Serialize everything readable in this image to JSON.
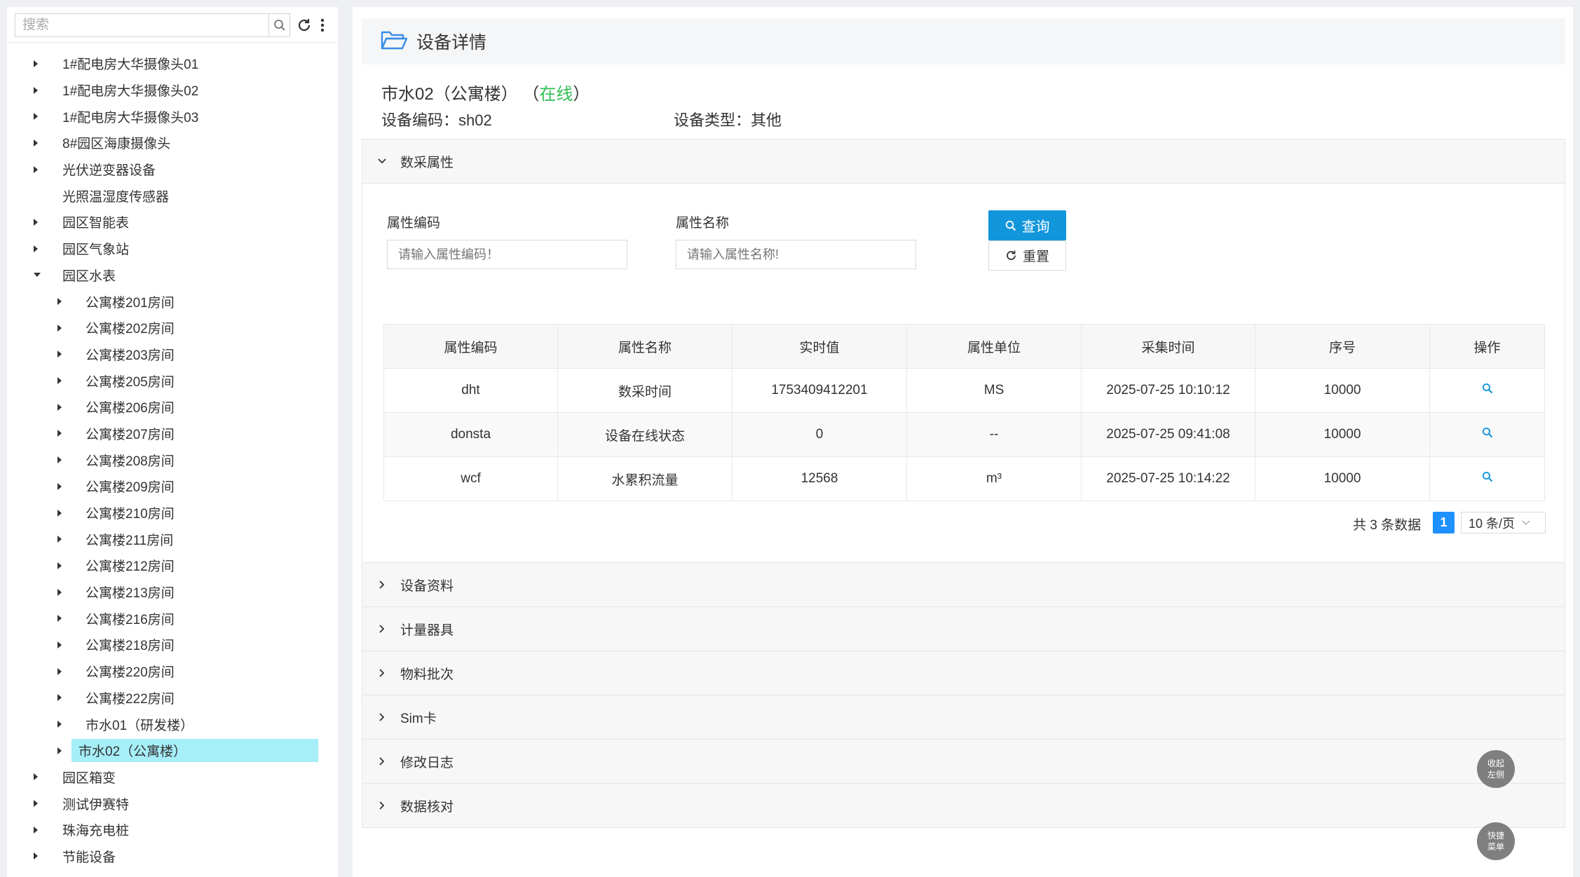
{
  "sidebar": {
    "search_placeholder": "搜索",
    "tree": [
      {
        "label": "1#配电房大华摄像头01",
        "level": 1,
        "caret": "right"
      },
      {
        "label": "1#配电房大华摄像头02",
        "level": 1,
        "caret": "right"
      },
      {
        "label": "1#配电房大华摄像头03",
        "level": 1,
        "caret": "right"
      },
      {
        "label": "8#园区海康摄像头",
        "level": 1,
        "caret": "right"
      },
      {
        "label": "光伏逆变器设备",
        "level": 1,
        "caret": "right"
      },
      {
        "label": "光照温湿度传感器",
        "level": 1,
        "caret": "none"
      },
      {
        "label": "园区智能表",
        "level": 1,
        "caret": "right"
      },
      {
        "label": "园区气象站",
        "level": 1,
        "caret": "right"
      },
      {
        "label": "园区水表",
        "level": 1,
        "caret": "down"
      },
      {
        "label": "公寓楼201房间",
        "level": 2,
        "caret": "right"
      },
      {
        "label": "公寓楼202房间",
        "level": 2,
        "caret": "right"
      },
      {
        "label": "公寓楼203房间",
        "level": 2,
        "caret": "right"
      },
      {
        "label": "公寓楼205房间",
        "level": 2,
        "caret": "right"
      },
      {
        "label": "公寓楼206房间",
        "level": 2,
        "caret": "right"
      },
      {
        "label": "公寓楼207房间",
        "level": 2,
        "caret": "right"
      },
      {
        "label": "公寓楼208房间",
        "level": 2,
        "caret": "right"
      },
      {
        "label": "公寓楼209房间",
        "level": 2,
        "caret": "right"
      },
      {
        "label": "公寓楼210房间",
        "level": 2,
        "caret": "right"
      },
      {
        "label": "公寓楼211房间",
        "level": 2,
        "caret": "right"
      },
      {
        "label": "公寓楼212房间",
        "level": 2,
        "caret": "right"
      },
      {
        "label": "公寓楼213房间",
        "level": 2,
        "caret": "right"
      },
      {
        "label": "公寓楼216房间",
        "level": 2,
        "caret": "right"
      },
      {
        "label": "公寓楼218房间",
        "level": 2,
        "caret": "right"
      },
      {
        "label": "公寓楼220房间",
        "level": 2,
        "caret": "right"
      },
      {
        "label": "公寓楼222房间",
        "level": 2,
        "caret": "right"
      },
      {
        "label": "市水01（研发楼）",
        "level": 2,
        "caret": "right"
      },
      {
        "label": "市水02（公寓楼）",
        "level": 2,
        "caret": "right",
        "selected": true
      },
      {
        "label": "园区箱变",
        "level": 1,
        "caret": "right"
      },
      {
        "label": "测试伊赛特",
        "level": 1,
        "caret": "right"
      },
      {
        "label": "珠海充电桩",
        "level": 1,
        "caret": "right"
      },
      {
        "label": "节能设备",
        "level": 1,
        "caret": "right"
      }
    ]
  },
  "header": {
    "title": "设备详情"
  },
  "device": {
    "name": "市水02（公寓楼）",
    "status_open": "（",
    "status": "在线",
    "status_close": "）",
    "code_label": "设备编码：",
    "code": "sh02",
    "type_label": "设备类型：",
    "type": "其他"
  },
  "sections": {
    "data_attrs": "数采属性",
    "others": [
      "设备资料",
      "计量器具",
      "物料批次",
      "Sim卡",
      "修改日志",
      "数据核对"
    ]
  },
  "form": {
    "code_label": "属性编码",
    "code_placeholder": "请输入属性编码！",
    "name_label": "属性名称",
    "name_placeholder": "请输入属性名称!",
    "query_label": "查询",
    "reset_label": "重置"
  },
  "table": {
    "columns": [
      "属性编码",
      "属性名称",
      "实时值",
      "属性单位",
      "采集时间",
      "序号",
      "操作"
    ],
    "rows": [
      [
        "dht",
        "数采时间",
        "1753409412201",
        "MS",
        "2025-07-25 10:10:12",
        "10000"
      ],
      [
        "donsta",
        "设备在线状态",
        "0",
        "--",
        "2025-07-25 09:41:08",
        "10000"
      ],
      [
        "wcf",
        "水累积流量",
        "12568",
        "m³",
        "2025-07-25 10:14:22",
        "10000"
      ]
    ]
  },
  "pagination": {
    "total": "共 3 条数据",
    "page": "1",
    "page_size": "10 条/页"
  },
  "float": {
    "collapse_l1": "收起",
    "collapse_l2": "左侧",
    "quick_l1": "快捷",
    "quick_l2": "菜单"
  },
  "colors": {
    "accent": "#1296db",
    "online": "#2fbe54",
    "selected": "#a6eef8"
  }
}
